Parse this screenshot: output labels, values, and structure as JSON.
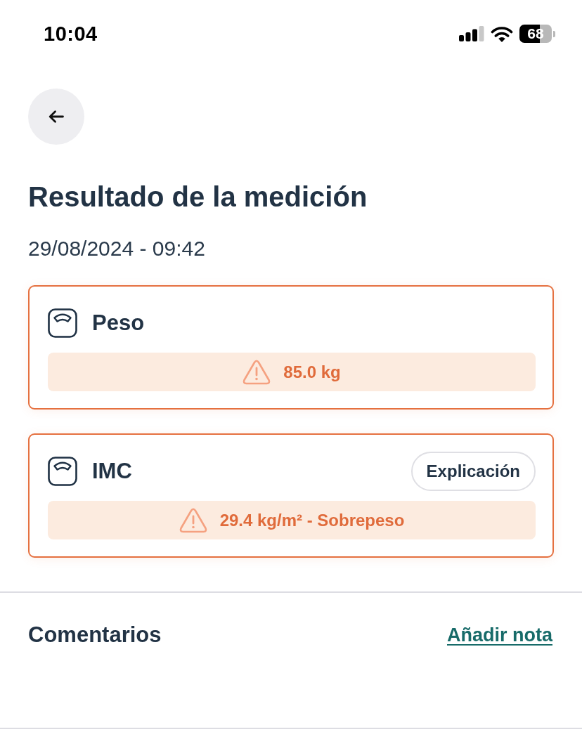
{
  "status_bar": {
    "time": "10:04",
    "battery": "68"
  },
  "title": "Resultado de la medición",
  "date": "29/08/2024 - 09:42",
  "measurements": [
    {
      "name": "Peso",
      "value": "85.0 kg",
      "warning": true
    },
    {
      "name": "IMC",
      "value": "29.4 kg/m² - Sobrepeso",
      "warning": true,
      "action": "Explicación"
    }
  ],
  "comments": {
    "title": "Comentarios",
    "action": "Añadir nota"
  }
}
